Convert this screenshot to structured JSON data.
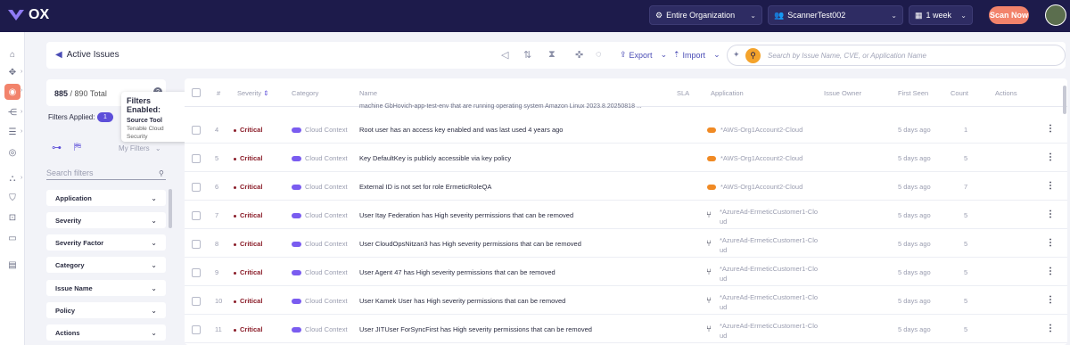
{
  "app": {
    "brand": "OX"
  },
  "topbar": {
    "org_selector": "Entire Organization",
    "user_selector": "ScannerTest002",
    "time_selector": "1 week",
    "scan_button": "Scan Now"
  },
  "toolbar": {
    "title": "Active Issues",
    "export_label": "Export",
    "import_label": "Import",
    "search_placeholder": "Search by Issue Name, CVE, or Application Name"
  },
  "filters": {
    "total_filtered": "885",
    "total_all": "/ 890",
    "total_word": "Total",
    "applied_label": "Filters Applied:",
    "applied_count": "1",
    "tooltip_title": "Filters Enabled:",
    "tooltip_filter_name": "Source Tool",
    "tooltip_filter_value": "Tenable Cloud Security",
    "my_filters": "My Filters",
    "search_placeholder": "Search filters",
    "facets": [
      "Application",
      "Severity",
      "Severity Factor",
      "Category",
      "Issue Name",
      "Policy",
      "Actions"
    ]
  },
  "table": {
    "columns": {
      "num": "#",
      "severity": "Severity",
      "category": "Category",
      "name": "Name",
      "sla": "SLA",
      "application": "Application",
      "owner": "Issue Owner",
      "first_seen": "First Seen",
      "count": "Count",
      "actions": "Actions"
    },
    "partial_row": "machine GbHovich-app-test-env that are running operating system Amazon Linux 2023.8.20250818 ...",
    "rows": [
      {
        "num": "4",
        "severity": "Critical",
        "category": "Cloud Context",
        "name": "Root user has an access key enabled and was last used 4 years ago",
        "app": "*AWS-Org1Account2-Cloud",
        "app_type": "aws",
        "first_seen": "5 days ago",
        "count": "1"
      },
      {
        "num": "5",
        "severity": "Critical",
        "category": "Cloud Context",
        "name": "Key DefaultKey is publicly accessible via key policy",
        "app": "*AWS-Org1Account2-Cloud",
        "app_type": "aws",
        "first_seen": "5 days ago",
        "count": "5"
      },
      {
        "num": "6",
        "severity": "Critical",
        "category": "Cloud Context",
        "name": "External ID is not set for role ErmeticRoleQA",
        "app": "*AWS-Org1Account2-Cloud",
        "app_type": "aws",
        "first_seen": "5 days ago",
        "count": "7"
      },
      {
        "num": "7",
        "severity": "Critical",
        "category": "Cloud Context",
        "name": "User Itay Federation has High severity permissions that can be removed",
        "app1": "*AzureAd-ErmeticCustomer1-Clo",
        "app2": "ud",
        "app_type": "azure",
        "first_seen": "5 days ago",
        "count": "5"
      },
      {
        "num": "8",
        "severity": "Critical",
        "category": "Cloud Context",
        "name": "User CloudOpsNitzan3 has High severity permissions that can be removed",
        "app1": "*AzureAd-ErmeticCustomer1-Clo",
        "app2": "ud",
        "app_type": "azure",
        "first_seen": "5 days ago",
        "count": "5"
      },
      {
        "num": "9",
        "severity": "Critical",
        "category": "Cloud Context",
        "name": "User Agent 47 has High severity permissions that can be removed",
        "app1": "*AzureAd-ErmeticCustomer1-Clo",
        "app2": "ud",
        "app_type": "azure",
        "first_seen": "5 days ago",
        "count": "5"
      },
      {
        "num": "10",
        "severity": "Critical",
        "category": "Cloud Context",
        "name": "User Kamek User has High severity permissions that can be removed",
        "app1": "*AzureAd-ErmeticCustomer1-Clo",
        "app2": "ud",
        "app_type": "azure",
        "first_seen": "5 days ago",
        "count": "5"
      },
      {
        "num": "11",
        "severity": "Critical",
        "category": "Cloud Context",
        "name": "User JITUser ForSyncFirst has High severity permissions that can be removed",
        "app1": "*AzureAd-ErmeticCustomer1-Clo",
        "app2": "ud",
        "app_type": "azure",
        "first_seen": "5 days ago",
        "count": "5"
      }
    ]
  },
  "colors": {
    "nav_bg": "#1d1b4b",
    "accent": "#5d4fd9",
    "scan": "#f2836b",
    "critical": "#8b1e2a",
    "search_orb": "#f4a32b"
  }
}
